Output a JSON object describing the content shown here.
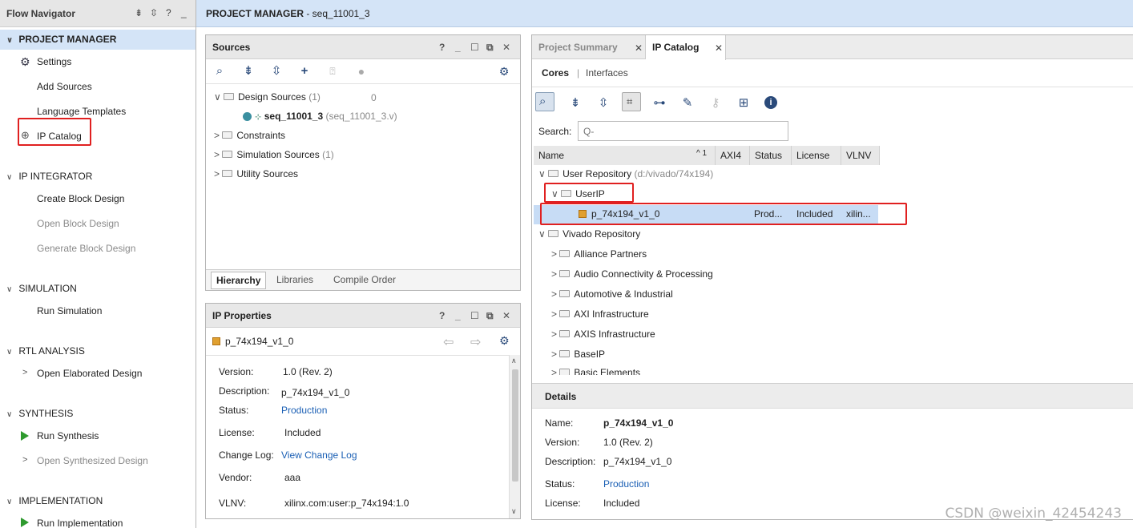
{
  "flow_nav": {
    "title": "Flow Navigator",
    "sections": [
      {
        "label": "PROJECT MANAGER",
        "items": [
          "Settings",
          "Add Sources",
          "Language Templates",
          "IP Catalog"
        ]
      },
      {
        "label": "IP INTEGRATOR",
        "items": [
          "Create Block Design",
          "Open Block Design",
          "Generate Block Design"
        ]
      },
      {
        "label": "SIMULATION",
        "items": [
          "Run Simulation"
        ]
      },
      {
        "label": "RTL ANALYSIS",
        "items": [
          "Open Elaborated Design"
        ]
      },
      {
        "label": "SYNTHESIS",
        "items": [
          "Run Synthesis",
          "Open Synthesized Design"
        ]
      },
      {
        "label": "IMPLEMENTATION",
        "items": [
          "Run Implementation"
        ]
      }
    ]
  },
  "topbar": {
    "title": "PROJECT MANAGER",
    "project": " - seq_11001_3"
  },
  "sources": {
    "title": "Sources",
    "count": "0",
    "tree": {
      "design_sources": "Design Sources",
      "design_count": "(1)",
      "top_module": "seq_11001_3",
      "top_file": "(seq_11001_3.v)",
      "constraints": "Constraints",
      "sim_sources": "Simulation Sources",
      "sim_count": "(1)",
      "utility": "Utility Sources"
    },
    "tabs": [
      "Hierarchy",
      "Libraries",
      "Compile Order"
    ]
  },
  "ip_props": {
    "title": "IP Properties",
    "ip_name": "p_74x194_v1_0",
    "props": {
      "version_label": "Version:",
      "version": "1.0 (Rev. 2)",
      "desc_label": "Description:",
      "desc": "p_74x194_v1_0",
      "status_label": "Status:",
      "status": "Production",
      "license_label": "License:",
      "license": "Included",
      "changelog_label": "Change Log:",
      "changelog": "View Change Log",
      "vendor_label": "Vendor:",
      "vendor": "aaa",
      "vlnv_label": "VLNV:",
      "vlnv": "xilinx.com:user:p_74x194:1.0"
    }
  },
  "right": {
    "tabs": [
      "Project Summary",
      "IP Catalog"
    ],
    "subtabs": [
      "Cores",
      "Interfaces"
    ],
    "search_label": "Search:",
    "search_placeholder": "Q-",
    "columns": [
      "Name",
      "AXI4",
      "Status",
      "License",
      "VLNV"
    ],
    "sort_indicator": "^ 1",
    "user_repo": "User Repository",
    "user_repo_path": "(d:/vivado/74x194)",
    "userip": "UserIP",
    "ip_row": {
      "name": "p_74x194_v1_0",
      "status": "Prod...",
      "license": "Included",
      "vlnv": "xilin..."
    },
    "vivado_repo": "Vivado Repository",
    "categories": [
      "Alliance Partners",
      "Audio Connectivity & Processing",
      "Automotive & Industrial",
      "AXI Infrastructure",
      "AXIS Infrastructure",
      "BaseIP",
      "Basic Elements"
    ]
  },
  "details": {
    "title": "Details",
    "name_label": "Name:",
    "name": "p_74x194_v1_0",
    "version_label": "Version:",
    "version": "1.0 (Rev. 2)",
    "desc_label": "Description:",
    "desc": "p_74x194_v1_0",
    "status_label": "Status:",
    "status": "Production",
    "license_label": "License:",
    "license": "Included"
  },
  "watermark": "CSDN @weixin_42454243"
}
